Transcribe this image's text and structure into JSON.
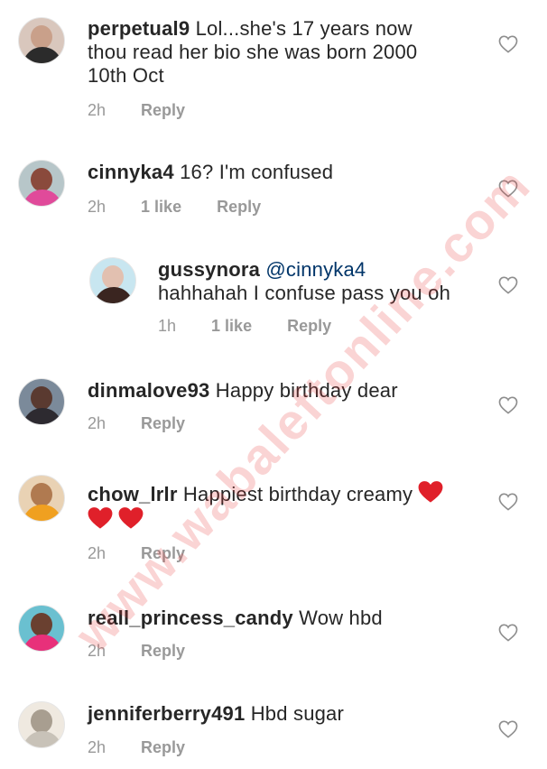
{
  "comments": [
    {
      "username": "perpetual9",
      "lines": [
        "Lol...she's 17 years now",
        "thou read her bio she was born 2000",
        "10th Oct"
      ],
      "time": "2h",
      "likes": "",
      "reply": "Reply",
      "avatar_colors": [
        "#d9c7bd",
        "#2b2b2b"
      ]
    },
    {
      "username": "cinnyka4",
      "lines": [
        "16? I'm confused"
      ],
      "time": "2h",
      "likes": "1 like",
      "reply": "Reply",
      "avatar_colors": [
        "#8a4a3c",
        "#e04a9a"
      ]
    },
    {
      "username": "gussynora",
      "mention": "@cinnyka4",
      "lines": [
        "hahhahah I confuse pass you oh"
      ],
      "time": "1h",
      "likes": "1 like",
      "reply": "Reply",
      "avatar_colors": [
        "#3a2520",
        "#c8e6f0"
      ]
    },
    {
      "username": "dinmalove93",
      "lines": [
        "Happy birthday dear"
      ],
      "time": "2h",
      "likes": "",
      "reply": "Reply",
      "avatar_colors": [
        "#5a3a30",
        "#7b8a9a"
      ]
    },
    {
      "username": "chow_lrlr",
      "lines": [
        "Happiest birthday creamy"
      ],
      "time": "2h",
      "likes": "",
      "reply": "Reply",
      "avatar_colors": [
        "#b07a50",
        "#f0a020"
      ]
    },
    {
      "username": "reall_princess_candy",
      "lines": [
        "Wow hbd"
      ],
      "time": "2h",
      "likes": "",
      "reply": "Reply",
      "avatar_colors": [
        "#6a4030",
        "#e8307a"
      ]
    },
    {
      "username": "jenniferberry491",
      "lines": [
        "Hbd sugar"
      ],
      "time": "2h",
      "likes": "",
      "reply": "Reply",
      "avatar_colors": [
        "#c8c2b8",
        "#efe9e0"
      ]
    }
  ],
  "watermark": "www.wabaleftonline.com",
  "icons": {
    "like": "heart-outline-icon",
    "emoji": "red-heart-emoji"
  },
  "colors": {
    "text": "#262626",
    "meta": "#999999",
    "mention": "#003569",
    "heart_emoji": "#e0202a"
  }
}
